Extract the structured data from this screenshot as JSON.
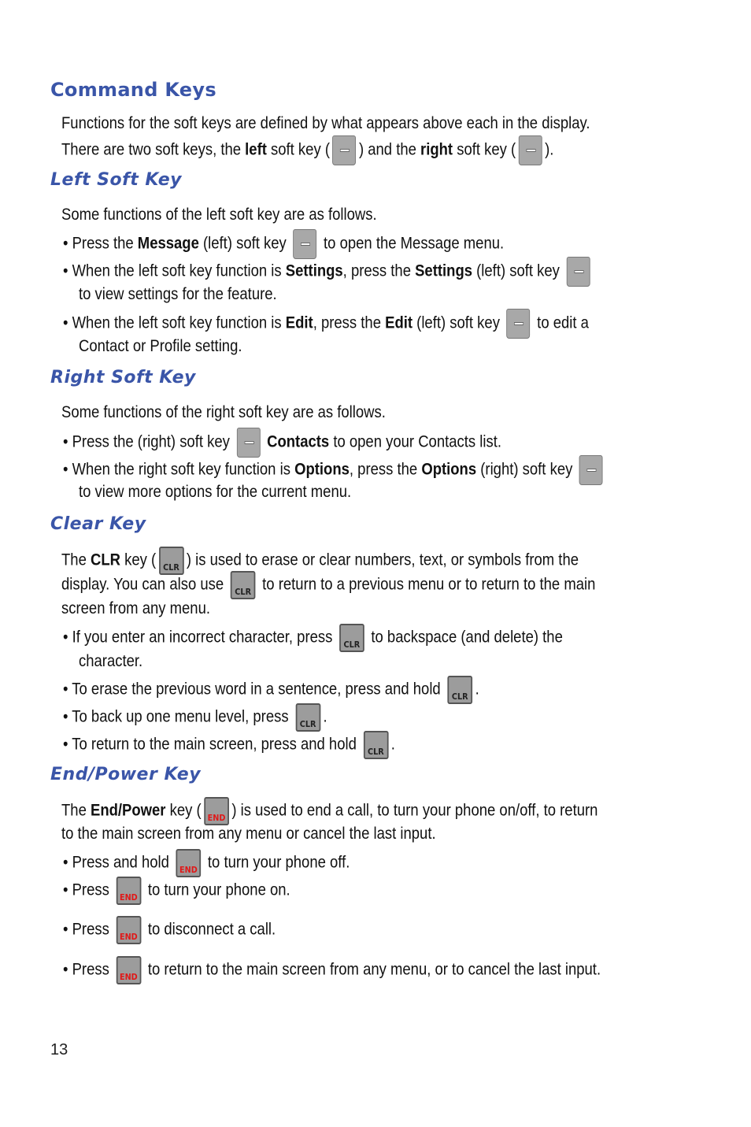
{
  "sections": {
    "command_keys": {
      "title": "Command Keys",
      "line1": "Functions for the soft keys are defined by what appears above each in the display.",
      "line2_a": "There are two soft keys, the ",
      "line2_b": "left",
      "line2_c": " soft key (",
      "line2_d": ") and the ",
      "line2_e": "right",
      "line2_f": " soft key (",
      "line2_g": ")."
    },
    "left_soft_key": {
      "title": "Left Soft Key",
      "intro": "Some functions of the left soft key are as follows.",
      "b1_a": "• Press the ",
      "b1_b": "Message",
      "b1_c": " (left) soft key",
      "b1_d": "to open the Message menu.",
      "b2_a": "• When the left soft key function is ",
      "b2_b": "Settings",
      "b2_c": ", press the ",
      "b2_d": "Settings",
      "b2_e": " (left) soft key",
      "b2_f": "to view settings for the feature.",
      "b3_a": "• When the left soft key function is ",
      "b3_b": "Edit",
      "b3_c": ", press the ",
      "b3_d": "Edit",
      "b3_e": " (left) soft key",
      "b3_f": "to edit a",
      "b3_g": "Contact or Profile setting."
    },
    "right_soft_key": {
      "title": "Right Soft Key",
      "intro": "Some functions of the right soft key are as follows.",
      "b1_a": "• Press the (right) soft key",
      "b1_b": "Contacts",
      "b1_c": " to open your Contacts list.",
      "b2_a": "• When the right soft key function is ",
      "b2_b": "Options",
      "b2_c": ", press the ",
      "b2_d": "Options",
      "b2_e": " (right) soft key",
      "b2_f": "to view more options for the current menu."
    },
    "clear_key": {
      "title": "Clear Key",
      "p1_a": "The ",
      "p1_b": "CLR",
      "p1_c": " key (",
      "p1_d": ") is used to erase or clear numbers, text, or symbols from the",
      "p2_a": "display. You can also use",
      "p2_b": "to return to a previous menu or to return to the main",
      "p3": "screen from any menu.",
      "b1_a": "• If you enter an incorrect character, press",
      "b1_b": "to backspace (and delete) the",
      "b1_c": "character.",
      "b2_a": "• To erase the previous word in a sentence, press and hold",
      "b2_b": ".",
      "b3_a": "• To back up one menu level, press",
      "b3_b": ".",
      "b4_a": "• To return to the main screen, press and hold",
      "b4_b": "."
    },
    "end_key": {
      "title": "End/Power Key",
      "p1_a": "The ",
      "p1_b": "End/Power",
      "p1_c": " key (",
      "p1_d": ") is used to end a call, to turn your phone on/off, to return",
      "p2": "to the main screen from any menu or cancel the last input.",
      "b1_a": "• Press and hold",
      "b1_b": "to turn your phone off.",
      "b2_a": "• Press",
      "b2_b": "to turn your phone on.",
      "b3_a": "• Press",
      "b3_b": "to disconnect a call.",
      "b4_a": "• Press",
      "b4_b": "to return to the main screen from any menu, or to cancel the last input."
    }
  },
  "icons": {
    "clr_label": "CLR",
    "end_label": "END"
  },
  "page_number": "13"
}
